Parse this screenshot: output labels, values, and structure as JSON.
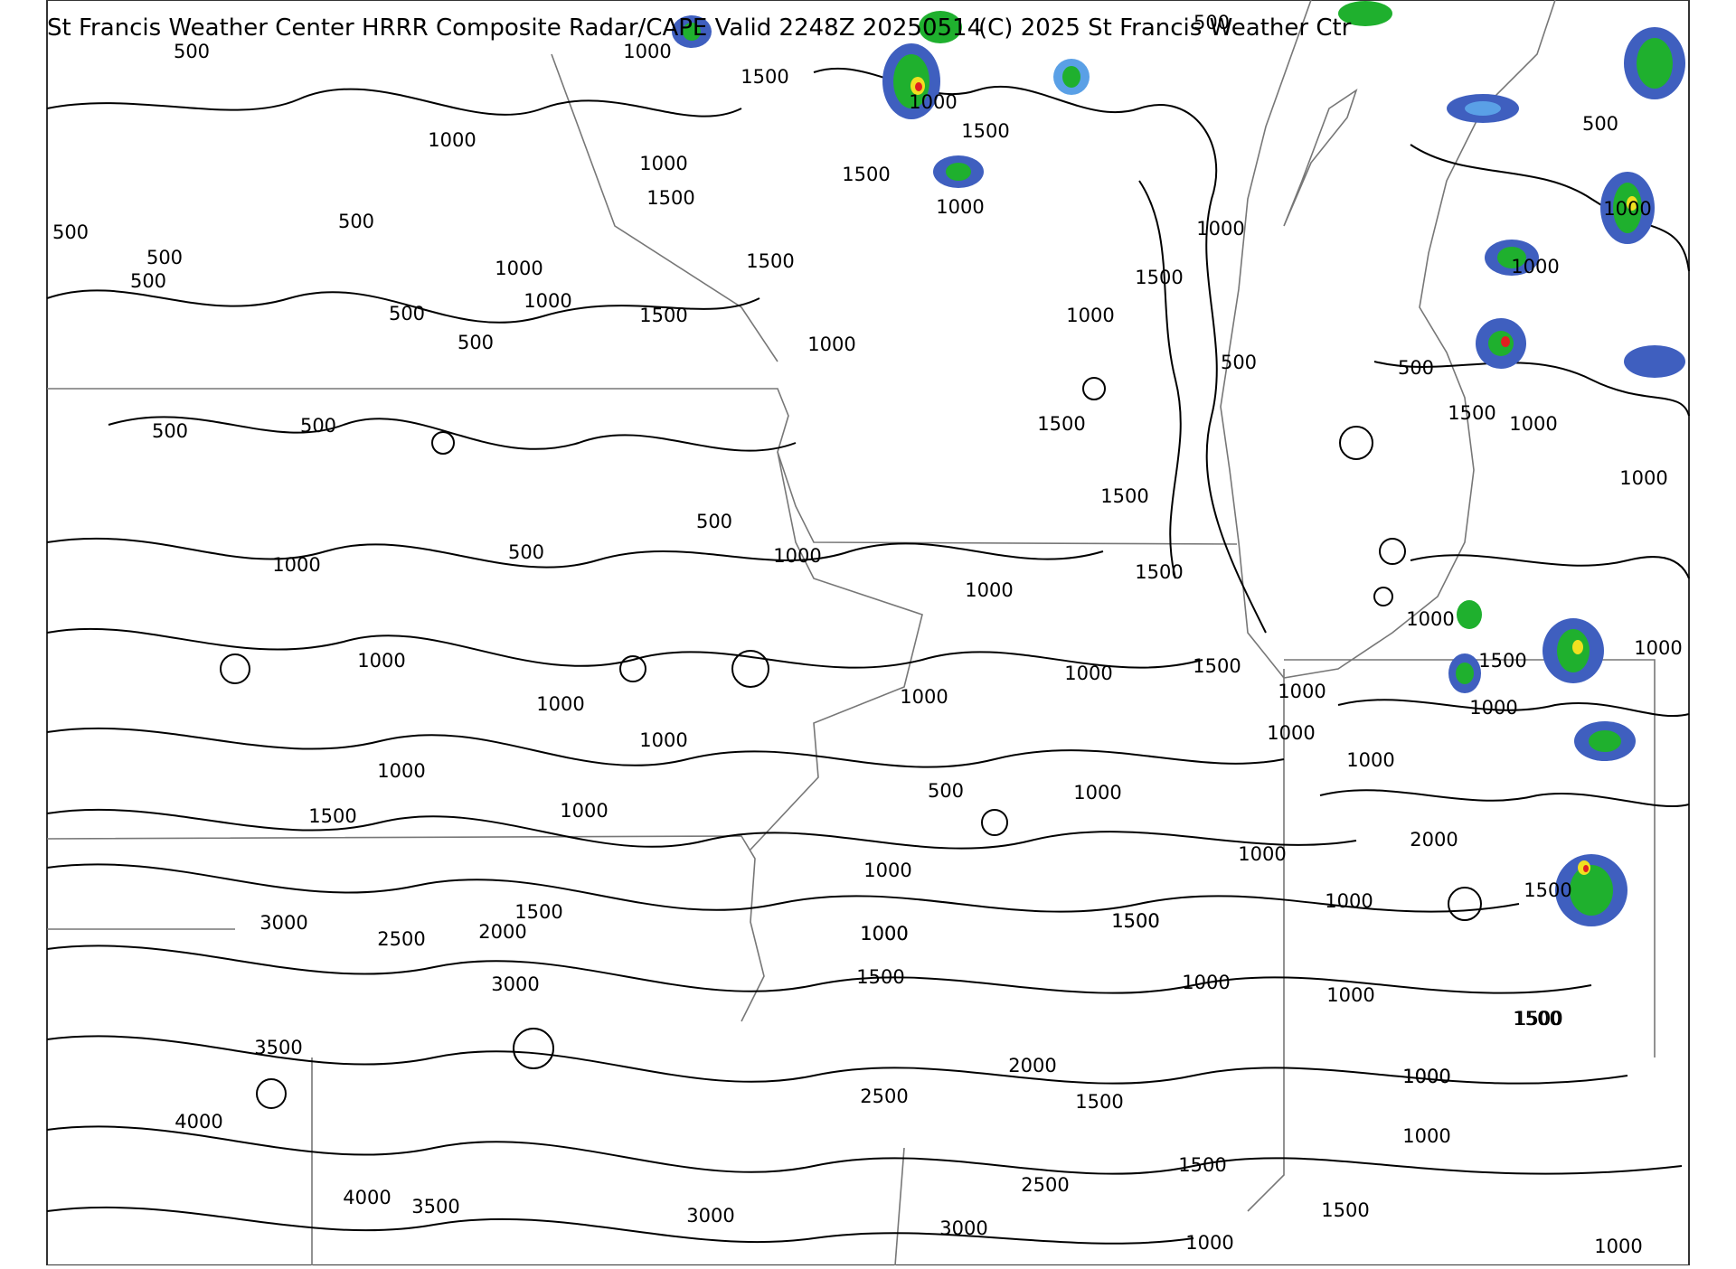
{
  "header": {
    "title": "St Francis Weather Center HRRR Composite Radar/CAPE  Valid  2248Z 20250514",
    "credit": "(C) 2025 St Francis Weather Ctr"
  },
  "legend_colors": {
    "radar_light": "#3f5fbf",
    "radar_moderate": "#5aa0e6",
    "radar_green": "#1fb02e",
    "radar_yellow": "#f0e020",
    "radar_red": "#e02020",
    "contour": "#000000",
    "boundaries": "#777777"
  },
  "cape_labels": [
    "500",
    "1000",
    "1500",
    "500",
    "1000",
    "1000",
    "1500",
    "1000",
    "1500",
    "500",
    "1000",
    "1500",
    "500",
    "500",
    "500",
    "1000",
    "1000",
    "500",
    "1500",
    "1500",
    "1000",
    "500",
    "1000",
    "1500",
    "1000",
    "500",
    "500",
    "1000",
    "1500",
    "1000",
    "1500",
    "500",
    "500",
    "500",
    "1000",
    "1500",
    "1500",
    "1000",
    "1000",
    "1000",
    "500",
    "1000",
    "500",
    "1000",
    "1500",
    "1000",
    "1500",
    "1000",
    "1000",
    "1000",
    "1000",
    "1000",
    "1000",
    "1000",
    "1000",
    "1000",
    "1000",
    "1000",
    "1000",
    "1000",
    "1500",
    "2000",
    "1000",
    "500",
    "1000",
    "1000",
    "1500",
    "3000",
    "2500",
    "2000",
    "1500",
    "1000",
    "1500",
    "1500",
    "1000",
    "1000",
    "3000",
    "1500",
    "1500",
    "1000",
    "3500",
    "4000",
    "2000",
    "1500",
    "2500",
    "1000",
    "1500",
    "1000",
    "4000",
    "3500",
    "3000",
    "3000",
    "2500",
    "1500",
    "1500",
    "1000",
    "1000"
  ]
}
